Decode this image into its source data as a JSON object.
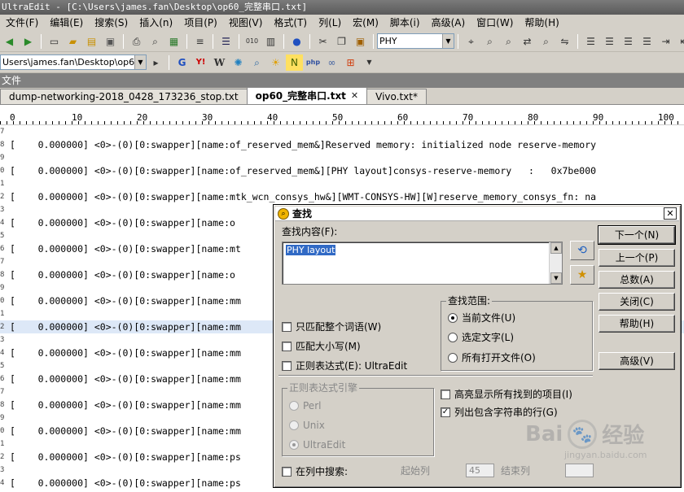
{
  "window": {
    "title": "UltraEdit - [C:\\Users\\james.fan\\Desktop\\op60_完整串口.txt]"
  },
  "menu": [
    "文件(F)",
    "编辑(E)",
    "搜索(S)",
    "插入(n)",
    "项目(P)",
    "视图(V)",
    "格式(T)",
    "列(L)",
    "宏(M)",
    "脚本(i)",
    "高级(A)",
    "窗口(W)",
    "帮助(H)"
  ],
  "toolbar": {
    "search_combo_value": "PHY",
    "path_combo_value": "Users\\james.fan\\Desktop\\op60_"
  },
  "file_pane": {
    "label": "文件"
  },
  "tabs": [
    {
      "label": "dump-networking-2018_0428_173236_stop.txt",
      "active": false
    },
    {
      "label": "op60_完整串口.txt",
      "active": true
    },
    {
      "label": "Vivo.txt*",
      "active": false
    }
  ],
  "ruler": [
    "0",
    "10",
    "20",
    "30",
    "40",
    "50",
    "60",
    "70",
    "80",
    "90",
    "100"
  ],
  "editor_lines": [
    {
      "num": "7",
      "text": "",
      "highlight": false
    },
    {
      "num": "8",
      "text": "[    0.000000] <0>-(0)[0:swapper][name:of_reserved_mem&]Reserved memory: initialized node reserve-memory",
      "highlight": false
    },
    {
      "num": "9",
      "text": "",
      "highlight": false
    },
    {
      "num": "0",
      "text": "[    0.000000] <0>-(0)[0:swapper][name:of_reserved_mem&][PHY layout]consys-reserve-memory   :   0x7be000",
      "highlight": false
    },
    {
      "num": "1",
      "text": "",
      "highlight": false
    },
    {
      "num": "2",
      "text": "[    0.000000] <0>-(0)[0:swapper][name:mtk_wcn_consys_hw&][WMT-CONSYS-HW][W]reserve_memory_consys_fn: na",
      "highlight": false
    },
    {
      "num": "3",
      "text": "",
      "highlight": false
    },
    {
      "num": "4",
      "text": "[    0.000000] <0>-(0)[0:swapper][name:o",
      "highlight": false
    },
    {
      "num": "5",
      "text": "",
      "highlight": false
    },
    {
      "num": "6",
      "text": "[    0.000000] <0>-(0)[0:swapper][name:mt",
      "highlight": false
    },
    {
      "num": "7",
      "text": "",
      "highlight": false
    },
    {
      "num": "8",
      "text": "[    0.000000] <0>-(0)[0:swapper][name:o",
      "highlight": false
    },
    {
      "num": "9",
      "text": "",
      "highlight": false
    },
    {
      "num": "0",
      "text": "[    0.000000] <0>-(0)[0:swapper][name:mm",
      "highlight": false
    },
    {
      "num": "1",
      "text": "",
      "highlight": false
    },
    {
      "num": "2",
      "text": "[    0.000000] <0>-(0)[0:swapper][name:mm",
      "highlight": true
    },
    {
      "num": "3",
      "text": "",
      "highlight": false
    },
    {
      "num": "4",
      "text": "[    0.000000] <0>-(0)[0:swapper][name:mm",
      "highlight": false
    },
    {
      "num": "5",
      "text": "",
      "highlight": false
    },
    {
      "num": "6",
      "text": "[    0.000000] <0>-(0)[0:swapper][name:mm",
      "highlight": false
    },
    {
      "num": "7",
      "text": "",
      "highlight": false
    },
    {
      "num": "8",
      "text": "[    0.000000] <0>-(0)[0:swapper][name:mm",
      "highlight": false
    },
    {
      "num": "9",
      "text": "",
      "highlight": false
    },
    {
      "num": "0",
      "text": "[    0.000000] <0>-(0)[0:swapper][name:mm",
      "highlight": false
    },
    {
      "num": "1",
      "text": "",
      "highlight": false
    },
    {
      "num": "2",
      "text": "[    0.000000] <0>-(0)[0:swapper][name:ps",
      "highlight": false
    },
    {
      "num": "3",
      "text": "",
      "highlight": false
    },
    {
      "num": "4",
      "text": "[    0.000000] <0>-(0)[0:swapper][name:ps",
      "highlight": false
    }
  ],
  "dialog": {
    "title": "查找",
    "find_label": "查找内容(F):",
    "find_value": "PHY layout",
    "buttons": {
      "find_next": "下一个(N)",
      "find_prev": "上一个(P)",
      "count": "总数(A)",
      "close": "关闭(C)",
      "help": "帮助(H)",
      "advanced": "高级(V)"
    },
    "options": {
      "match_word": {
        "label": "只匹配整个词语(W)",
        "checked": false
      },
      "match_case": {
        "label": "匹配大小写(M)",
        "checked": false
      },
      "regex": {
        "label": "正则表达式(E): UltraEdit",
        "checked": false
      }
    },
    "scope": {
      "title": "查找范围:",
      "items": [
        {
          "label": "当前文件(U)",
          "selected": true
        },
        {
          "label": "选定文字(L)",
          "selected": false
        },
        {
          "label": "所有打开文件(O)",
          "selected": false
        }
      ]
    },
    "regex_engine": {
      "title": "正则表达式引擎",
      "items": [
        {
          "label": "Perl",
          "selected": false
        },
        {
          "label": "Unix",
          "selected": false
        },
        {
          "label": "UltraEdit",
          "selected": true
        }
      ]
    },
    "highlight_all": {
      "label": "高亮显示所有找到的项目(I)",
      "checked": false
    },
    "list_lines": {
      "label": "列出包含字符串的行(G)",
      "checked": true
    },
    "column_search": {
      "label": "在列中搜索:",
      "checked": false,
      "start_label": "起始列",
      "start_value": "45",
      "end_label": "结束列"
    }
  },
  "watermark": {
    "brand": "Bai",
    "brand2": "经验",
    "url": "jingyan.baidu.com"
  }
}
